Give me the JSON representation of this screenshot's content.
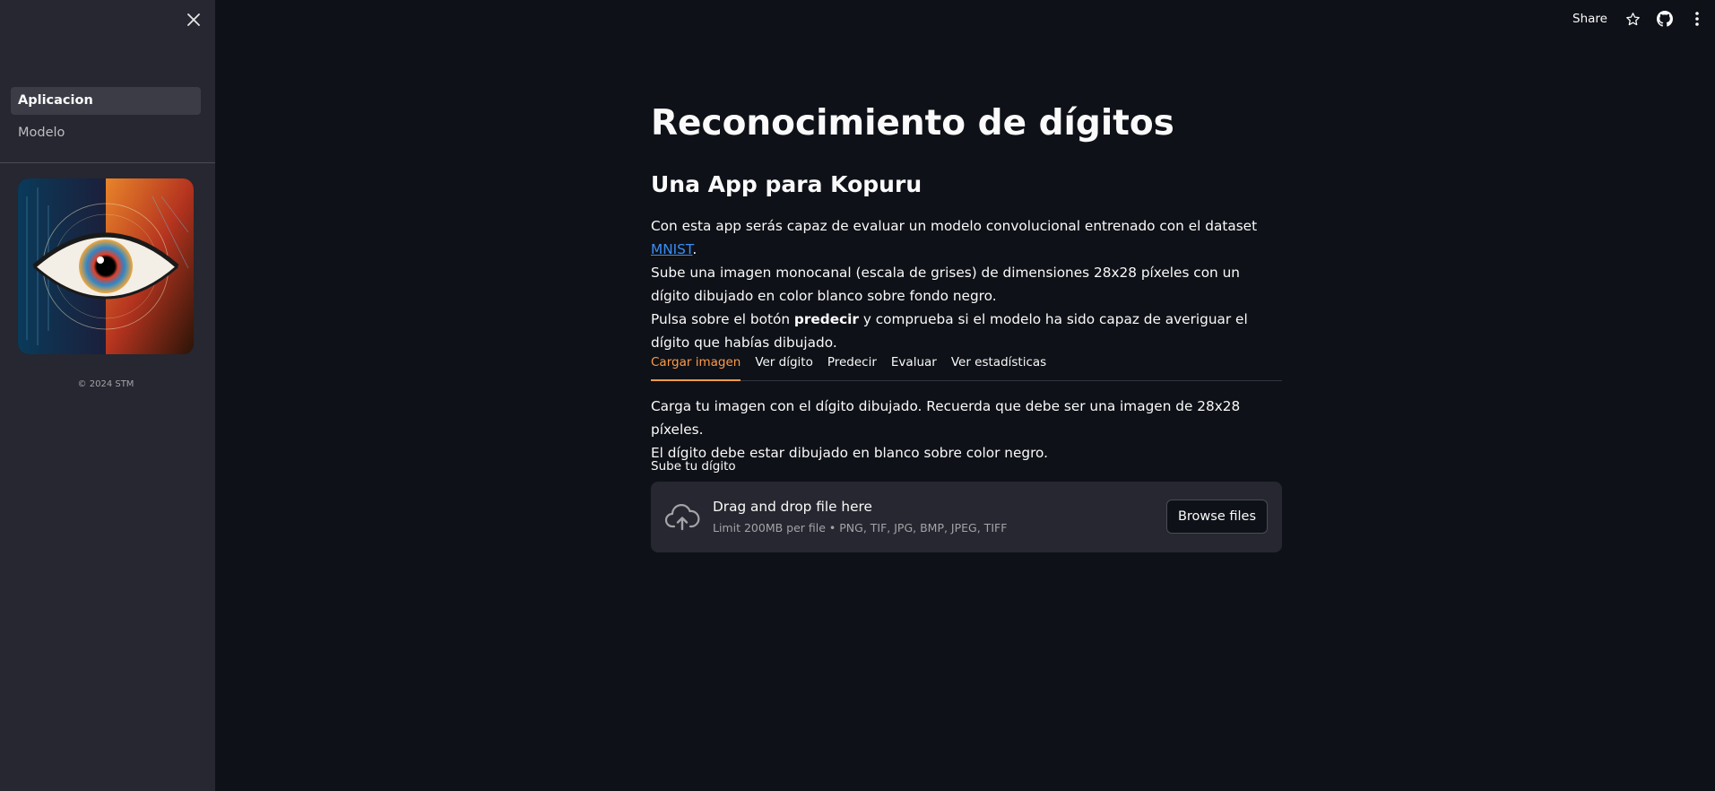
{
  "sidebar": {
    "close_icon": "close-icon",
    "nav_items": [
      {
        "label": "Aplicacion",
        "active": true
      },
      {
        "label": "Modelo",
        "active": false
      }
    ],
    "image_icon": "eye-illustration",
    "footer": "© 2024 STM"
  },
  "toolbar": {
    "share_label": "Share",
    "icons": [
      "star-icon",
      "github-icon",
      "more-vertical-icon"
    ]
  },
  "main": {
    "title": "Reconocimiento de dígitos",
    "subtitle": "Una App para Kopuru",
    "intro": {
      "line1_text": "Con esta app serás capaz de evaluar un modelo convolucional entrenado con el dataset ",
      "line1_link": "MNIST",
      "line1_end": ".",
      "line2": "Sube una imagen monocanal (escala de grises) de dimensiones 28x28 píxeles con un dígito dibujado en color blanco sobre fondo negro.",
      "line3_pre": "Pulsa sobre el botón ",
      "line3_bold": "predecir",
      "line3_post": " y comprueba si el modelo ha sido capaz de averiguar el dígito que habías dibujado."
    },
    "tabs": [
      {
        "label": "Cargar imagen",
        "active": true
      },
      {
        "label": "Ver dígito",
        "active": false
      },
      {
        "label": "Predecir",
        "active": false
      },
      {
        "label": "Evaluar",
        "active": false
      },
      {
        "label": "Ver estadísticas",
        "active": false
      }
    ],
    "tab_content": {
      "line1": "Carga tu imagen con el dígito dibujado. Recuerda que debe ser una imagen de 28x28 píxeles.",
      "line2": "El dígito debe estar dibujado en blanco sobre color negro.",
      "upload_label": "Sube tu dígito",
      "dropzone": {
        "icon": "cloud-upload-icon",
        "main_text": "Drag and drop file here",
        "sub_text": "Limit 200MB per file • PNG, TIF, JPG, BMP, JPEG, TIFF",
        "button_label": "Browse files"
      }
    }
  },
  "colors": {
    "background": "#0e1117",
    "sidebar": "#262730",
    "accent": "#ff9a46",
    "link": "#3a8ef6"
  }
}
